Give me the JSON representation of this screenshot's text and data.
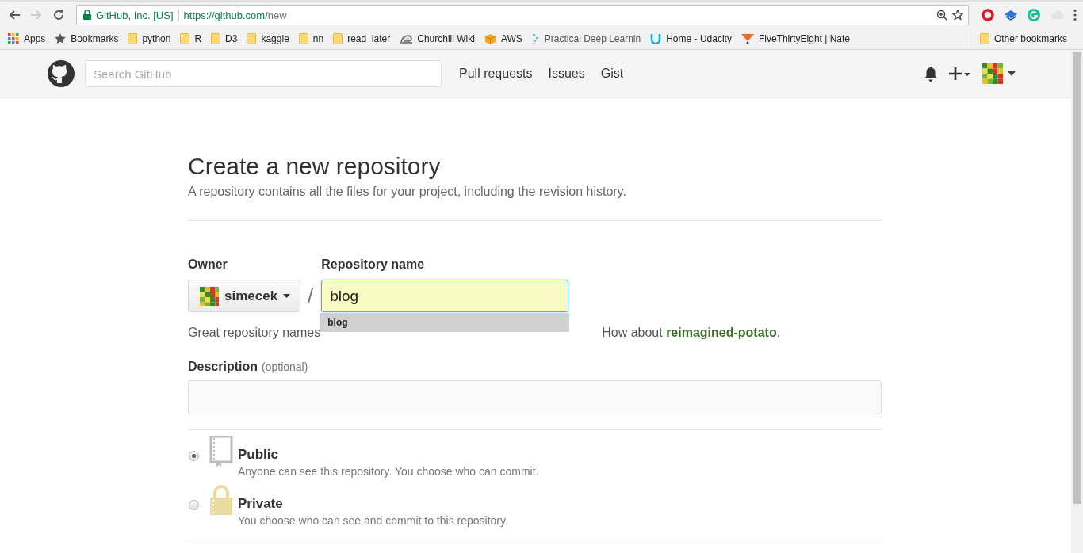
{
  "browser": {
    "back_disabled": false,
    "forward_disabled": true,
    "security_label": "GitHub, Inc. [US]",
    "url_host": "https://github.com/",
    "url_path": "new"
  },
  "bookmarks": [
    {
      "kind": "apps",
      "label": "Apps"
    },
    {
      "kind": "star",
      "label": "Bookmarks"
    },
    {
      "kind": "folder",
      "label": "python"
    },
    {
      "kind": "folder",
      "label": "R"
    },
    {
      "kind": "folder",
      "label": "D3"
    },
    {
      "kind": "folder",
      "label": "kaggle"
    },
    {
      "kind": "folder",
      "label": "nn"
    },
    {
      "kind": "folder",
      "label": "read_later"
    },
    {
      "kind": "cloud",
      "label": "Churchill Wiki"
    },
    {
      "kind": "box",
      "label": "AWS"
    },
    {
      "kind": "dots",
      "label": "Practical Deep Learnin"
    },
    {
      "kind": "u",
      "label": "Home - Udacity"
    },
    {
      "kind": "triangle",
      "label": "FiveThirtyEight | Nate"
    }
  ],
  "other_bookmarks": {
    "label": "Other bookmarks"
  },
  "header": {
    "search_placeholder": "Search GitHub",
    "nav": [
      "Pull requests",
      "Issues",
      "Gist"
    ]
  },
  "page": {
    "title": "Create a new repository",
    "subtitle": "A repository contains all the files for your project, including the revision history.",
    "owner_label": "Owner",
    "owner": "simecek",
    "slash": "/",
    "repo_label": "Repository name",
    "repo_value": "blog",
    "autocomplete": [
      "blog"
    ],
    "hint_before": "Great repository names",
    "hint_resume": "How about ",
    "hint_link": "reimagined-potato",
    "hint_after": ".",
    "description_label": "Description",
    "description_optional": "(optional)",
    "visibility": [
      {
        "kind": "public",
        "label": "Public",
        "note": "Anyone can see this repository. You choose who can commit.",
        "selected": true
      },
      {
        "kind": "private",
        "label": "Private",
        "note": "You choose who can see and commit to this repository.",
        "selected": false
      }
    ]
  }
}
